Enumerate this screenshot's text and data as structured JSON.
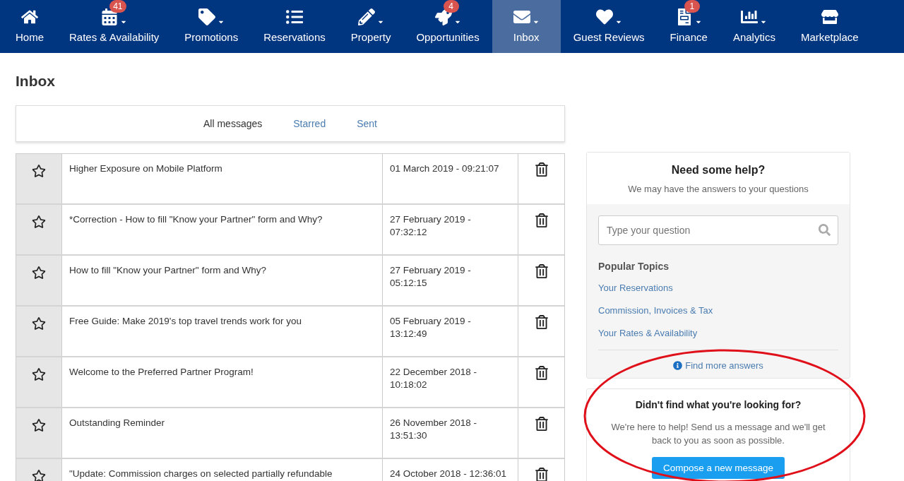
{
  "nav": [
    {
      "label": "Home",
      "dropdown": false,
      "selected": false
    },
    {
      "label": "Rates & Availability",
      "dropdown": true,
      "badge": "41",
      "selected": false
    },
    {
      "label": "Promotions",
      "dropdown": true,
      "selected": false
    },
    {
      "label": "Reservations",
      "dropdown": false,
      "selected": false
    },
    {
      "label": "Property",
      "dropdown": true,
      "selected": false
    },
    {
      "label": "Opportunities",
      "dropdown": true,
      "badge": "4",
      "selected": false
    },
    {
      "label": "Inbox",
      "dropdown": true,
      "selected": true
    },
    {
      "label": "Guest Reviews",
      "dropdown": true,
      "selected": false
    },
    {
      "label": "Finance",
      "dropdown": true,
      "badge": "1",
      "selected": false
    },
    {
      "label": "Analytics",
      "dropdown": true,
      "selected": false
    },
    {
      "label": "Marketplace",
      "dropdown": false,
      "selected": false
    }
  ],
  "page_title": "Inbox",
  "tabs": [
    {
      "label": "All messages",
      "selected": true
    },
    {
      "label": "Starred",
      "selected": false
    },
    {
      "label": "Sent",
      "selected": false
    }
  ],
  "messages": [
    {
      "subject": "Higher Exposure on Mobile Platform",
      "date": "01 March 2019 - 09:21:07"
    },
    {
      "subject": "*Correction - How to fill \"Know your Partner\" form and Why?",
      "date": "27 February 2019 - 07:32:12"
    },
    {
      "subject": "How to fill \"Know your Partner\" form and Why?",
      "date": "27 February 2019 - 05:12:15"
    },
    {
      "subject": "Free Guide: Make 2019's top travel trends work for you",
      "date": "05 February 2019 - 13:12:49"
    },
    {
      "subject": "Welcome to the Preferred Partner Program!",
      "date": "22 December 2018 - 10:18:02"
    },
    {
      "subject": "Outstanding Reminder",
      "date": "26 November 2018 - 13:51:30"
    },
    {
      "subject": "\"Update: Commission charges on selected partially refundable",
      "date": "24 October 2018 - 12:36:01"
    }
  ],
  "help": {
    "title": "Need some help?",
    "subtitle": "We may have the answers to your questions",
    "search_placeholder": "Type your question",
    "topics_title": "Popular Topics",
    "topics": [
      "Your Reservations",
      "Commission, Invoices & Tax",
      "Your Rates & Availability"
    ],
    "more_link": "Find more answers"
  },
  "contact": {
    "title": "Didn't find what you're looking for?",
    "text": "We're here to help! Send us a message and we'll get back to you as soon as possible.",
    "button": "Compose a new message"
  }
}
